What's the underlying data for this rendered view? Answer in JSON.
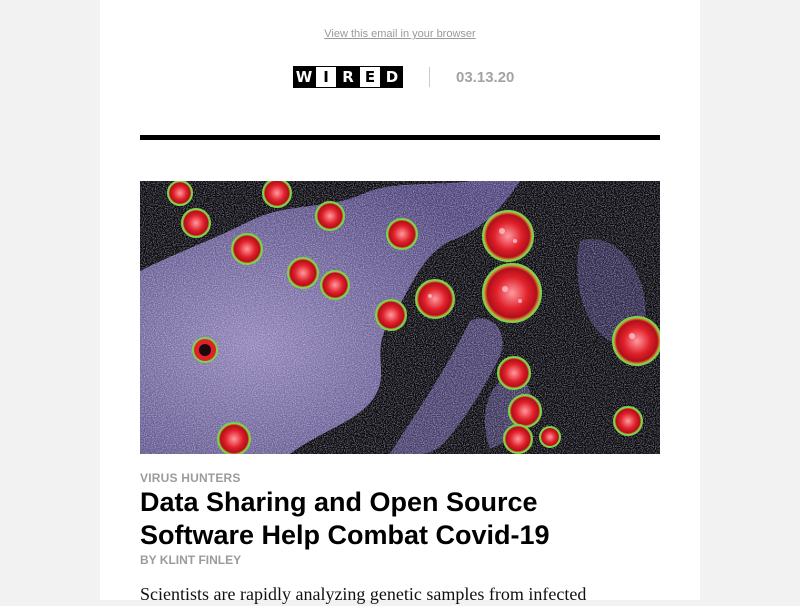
{
  "email": {
    "view_in_browser": "View this email in your browser",
    "logo_letters": [
      "W",
      "I",
      "R",
      "E",
      "D"
    ],
    "issue_date": "03.13.20"
  },
  "article": {
    "kicker": "VIRUS HUNTERS",
    "headline_line1": "Data Sharing and Open Source",
    "headline_line2": "Software Help Combat Covid-19",
    "byline": "BY KLINT FINLEY",
    "dek": "Scientists are rapidly analyzing genetic samples from infected"
  },
  "colors": {
    "page_background": "#f2f2f2",
    "card_background": "#ffffff",
    "muted_text": "#9b9b9b",
    "rule": "#000000",
    "virus_red": "#e0202a",
    "virus_ring": "#7bd34a",
    "cell_lavender": "#b4a8e0"
  },
  "icons": {
    "logo": "wired-logo"
  }
}
